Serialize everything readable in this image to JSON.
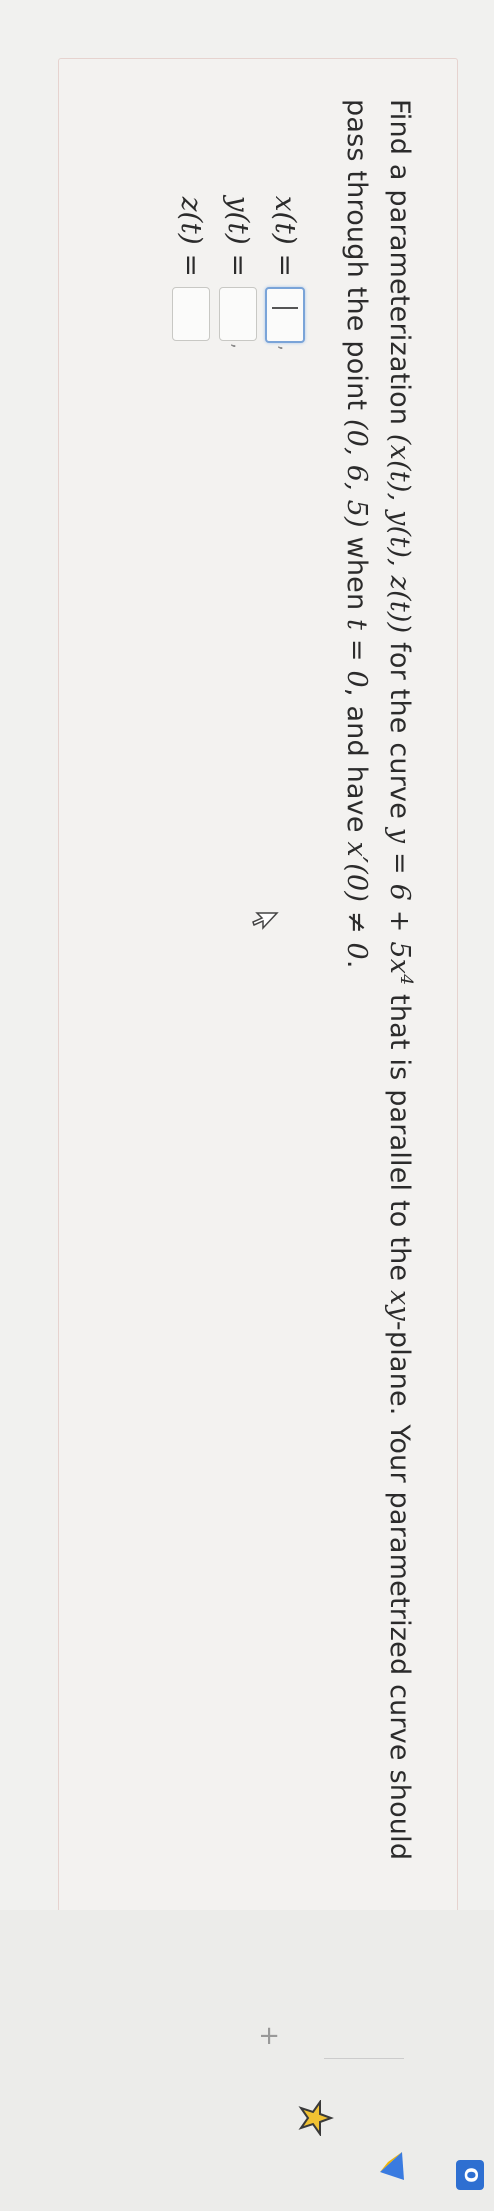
{
  "question": {
    "prefix": "Find a parameterization ",
    "tuple": "(x(t), y(t), z(t))",
    "mid1": " for the curve ",
    "curve": "y = 6 + 5x",
    "exp": "4",
    "mid2": " that is parallel to the ",
    "plane_var": "xy",
    "mid3": "-plane. Your parametrized curve should pass through the point ",
    "point": "(0, 6, 5)",
    "mid4": " when ",
    "tcond": "t = 0",
    "mid5": ", and have ",
    "deriv": "x′(0) ≠ 0",
    "end": "."
  },
  "answers": [
    {
      "label": "x(t) =",
      "value": ""
    },
    {
      "label": "y(t) =",
      "value": ""
    },
    {
      "label": "z(t) =",
      "value": ""
    }
  ],
  "dock": {
    "plus": "+",
    "badge": "O"
  }
}
